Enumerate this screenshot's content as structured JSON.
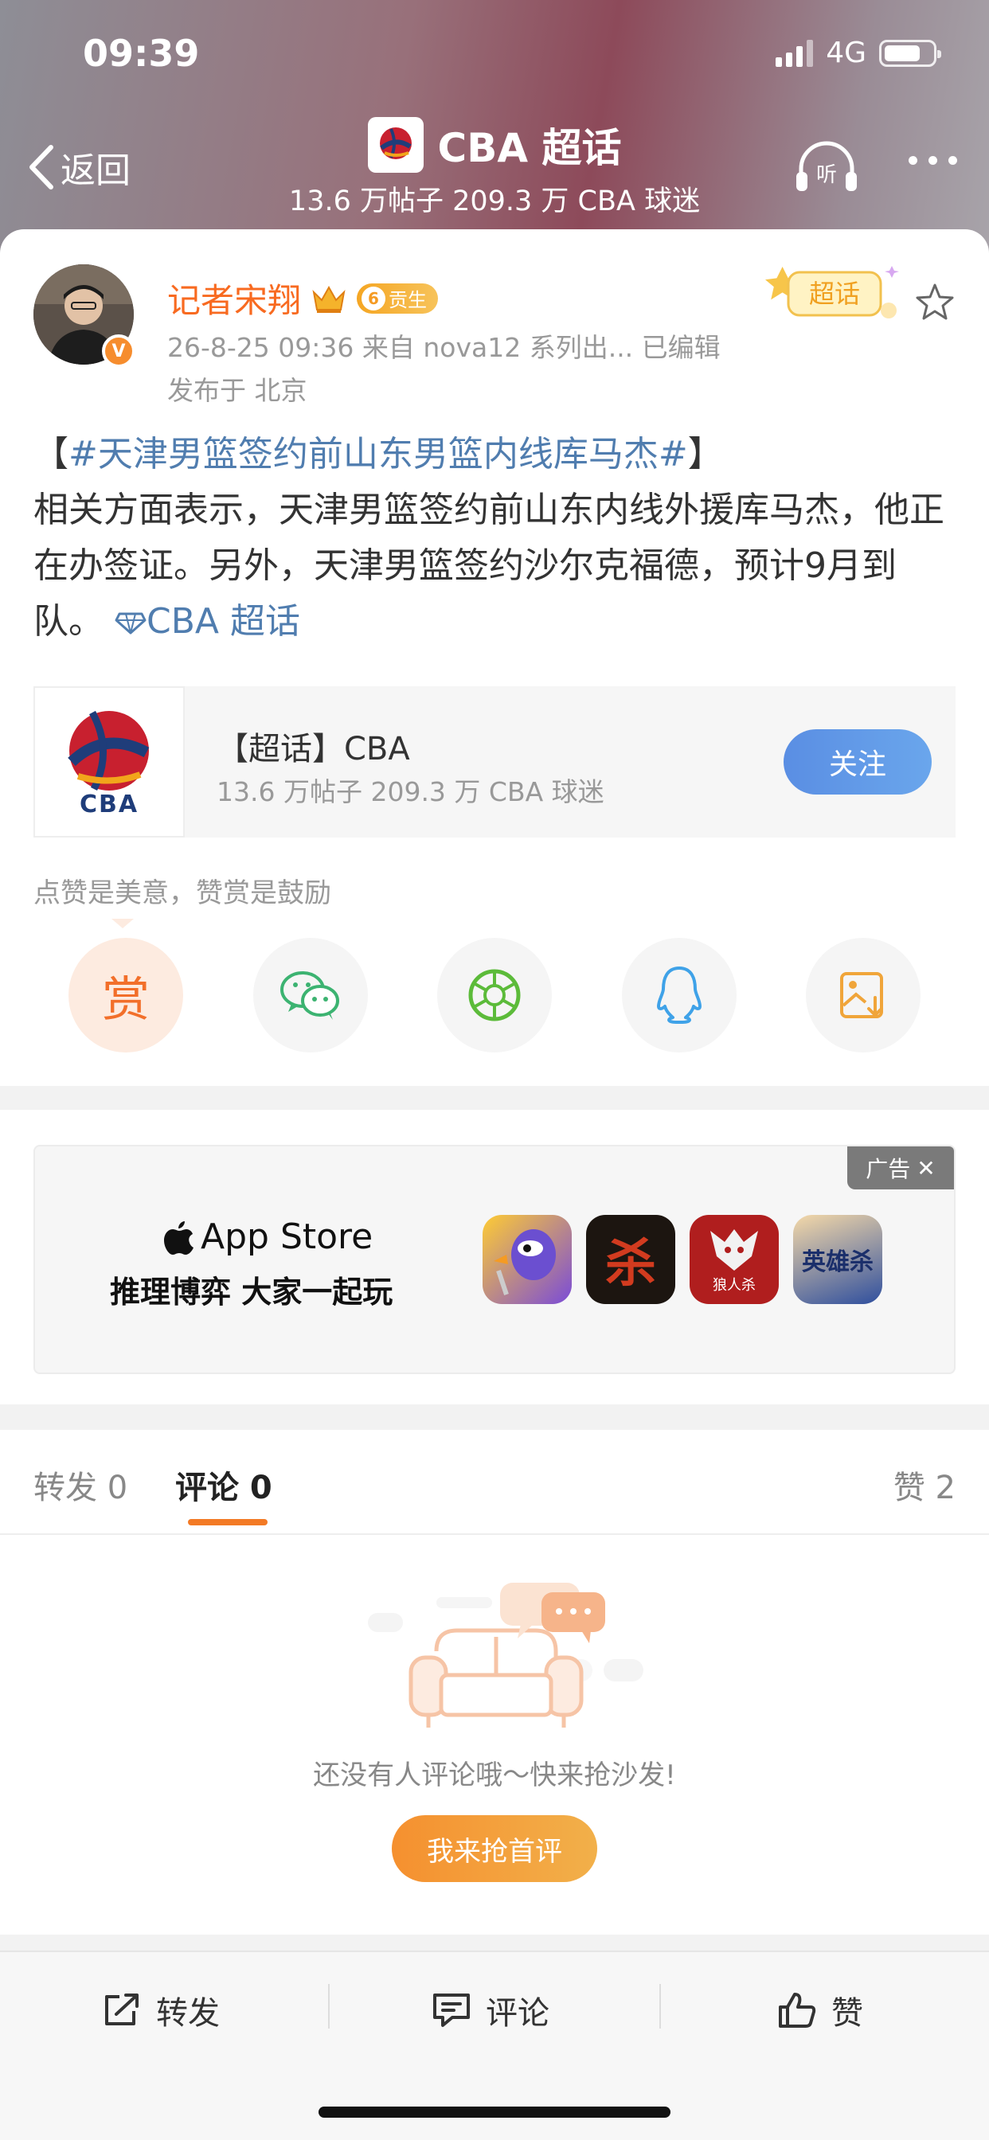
{
  "status_bar": {
    "time": "09:39",
    "network": "4G",
    "battery_level": 0.75
  },
  "nav": {
    "back_label": "返回",
    "title": "CBA 超话",
    "subtitle": "13.6 万帖子 209.3 万 CBA 球迷",
    "listen_label": "听"
  },
  "post": {
    "author": "记者宋翔",
    "level_badge": "6",
    "level_text": "贡生",
    "meta_line": "26-8-25 09:36  来自 nova12 系列出...  已编辑",
    "location": "发布于 北京",
    "chaohua_tag": "超话",
    "bracket_open": "【",
    "topic": "#天津男篮签约前山东男篮内线库马杰#",
    "bracket_close": "】",
    "body": "相关方面表示，天津男篮签约前山东内线外援库马杰，他正在办签证。另外，天津男篮签约沙尔克福德，预计9月到队。",
    "inline_link": "CBA 超话"
  },
  "supertopic_card": {
    "logo_text": "CBA",
    "title": "【超话】CBA",
    "subtitle": "13.6 万帖子 209.3 万 CBA 球迷",
    "follow_label": "关注"
  },
  "encourage_text": "点赞是美意，赞赏是鼓励",
  "share": {
    "reward_label": "赏",
    "icons": [
      "reward-icon",
      "wechat-icon",
      "moments-icon",
      "qq-icon",
      "save-image-icon"
    ]
  },
  "ad": {
    "tag": "广告",
    "brand": "App Store",
    "slogan": "推理博弈 大家一起玩",
    "app_icons": [
      "goose-game-icon",
      "sha-game-icon",
      "werewolf-game-icon",
      "sanguosha-game-icon"
    ],
    "app_icon_texts": [
      "",
      "杀",
      "狼人杀",
      "英雄杀"
    ]
  },
  "tabs": {
    "repost": "转发 0",
    "comment": "评论 0",
    "like": "赞 2"
  },
  "empty_state": {
    "text": "还没有人评论哦～快来抢沙发!",
    "button": "我来抢首评"
  },
  "bottom_bar": {
    "repost": "转发",
    "comment": "评论",
    "like": "赞"
  },
  "colors": {
    "accent_orange": "#f37a25",
    "link_blue": "#507daf",
    "follow_blue": "#5a8ee3"
  }
}
